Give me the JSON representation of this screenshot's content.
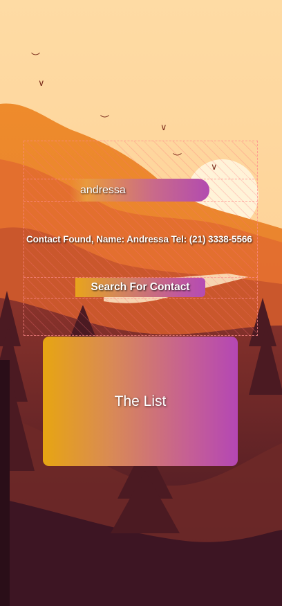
{
  "search": {
    "value": "andressa"
  },
  "result": {
    "text": "Contact Found, Name: Andressa Tel: (21) 3338-5566"
  },
  "search_button": {
    "label": "Search For Contact"
  },
  "list_card": {
    "label": "The List"
  },
  "colors": {
    "sky": "#fdd9a0",
    "mountain": "#e9812c",
    "forest": "#5e1f1d",
    "gradient_start": "#e7a512",
    "gradient_end": "#b447b4"
  }
}
